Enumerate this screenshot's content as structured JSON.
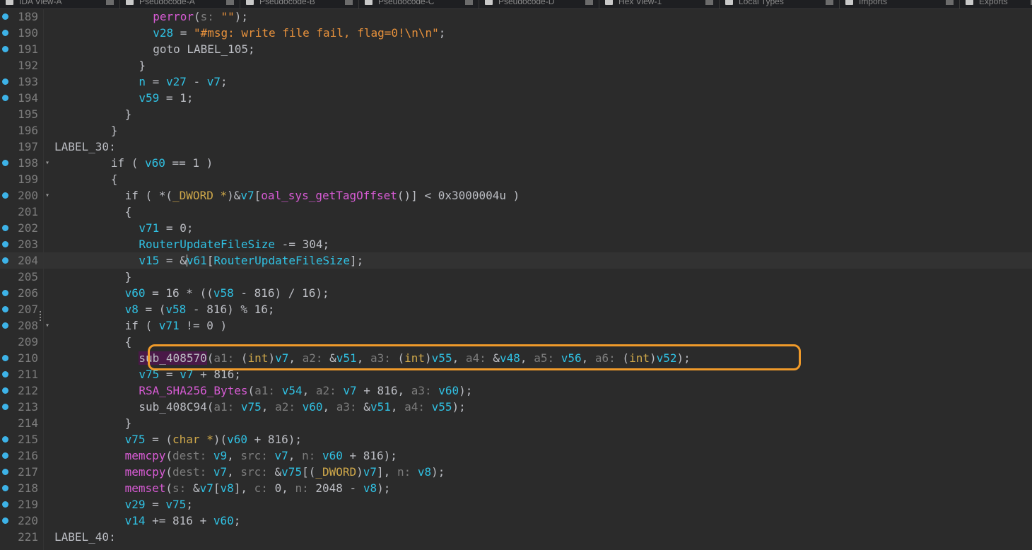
{
  "tabs": [
    {
      "label": "IDA View-A"
    },
    {
      "label": "Pseudocode-A"
    },
    {
      "label": "Pseudocode-B"
    },
    {
      "label": "Pseudocode-C"
    },
    {
      "label": "Pseudocode-D"
    },
    {
      "label": "Hex View-1"
    },
    {
      "label": "Local Types"
    },
    {
      "label": "Imports"
    },
    {
      "label": "Exports"
    }
  ],
  "lines": [
    {
      "no": "189",
      "bp": true,
      "fold": false,
      "current": false,
      "indent": 14,
      "tokens": [
        {
          "t": "f",
          "v": "perror"
        },
        {
          "t": "n",
          "v": "("
        },
        {
          "t": "h",
          "v": "s: "
        },
        {
          "t": "s",
          "v": "\"\""
        },
        {
          "t": "n",
          "v": ");"
        }
      ]
    },
    {
      "no": "190",
      "bp": true,
      "fold": false,
      "current": false,
      "indent": 14,
      "tokens": [
        {
          "t": "v",
          "v": "v28"
        },
        {
          "t": "n",
          "v": " = "
        },
        {
          "t": "s",
          "v": "\"#msg: write file fail, flag=0!\\n\\n\""
        },
        {
          "t": "n",
          "v": ";"
        }
      ]
    },
    {
      "no": "191",
      "bp": true,
      "fold": false,
      "current": false,
      "indent": 14,
      "tokens": [
        {
          "t": "n",
          "v": "goto LABEL_105;"
        }
      ]
    },
    {
      "no": "192",
      "bp": false,
      "fold": false,
      "current": false,
      "indent": 12,
      "tokens": [
        {
          "t": "n",
          "v": "}"
        }
      ]
    },
    {
      "no": "193",
      "bp": true,
      "fold": false,
      "current": false,
      "indent": 12,
      "tokens": [
        {
          "t": "v",
          "v": "n"
        },
        {
          "t": "n",
          "v": " = "
        },
        {
          "t": "v",
          "v": "v27"
        },
        {
          "t": "n",
          "v": " - "
        },
        {
          "t": "v",
          "v": "v7"
        },
        {
          "t": "n",
          "v": ";"
        }
      ]
    },
    {
      "no": "194",
      "bp": true,
      "fold": false,
      "current": false,
      "indent": 12,
      "tokens": [
        {
          "t": "v",
          "v": "v59"
        },
        {
          "t": "n",
          "v": " = 1;"
        }
      ]
    },
    {
      "no": "195",
      "bp": false,
      "fold": false,
      "current": false,
      "indent": 10,
      "tokens": [
        {
          "t": "n",
          "v": "}"
        }
      ]
    },
    {
      "no": "196",
      "bp": false,
      "fold": false,
      "current": false,
      "indent": 8,
      "tokens": [
        {
          "t": "n",
          "v": "}"
        }
      ]
    },
    {
      "no": "197",
      "bp": false,
      "fold": false,
      "current": false,
      "indent": 0,
      "tokens": [
        {
          "t": "n",
          "v": "LABEL_30:"
        }
      ]
    },
    {
      "no": "198",
      "bp": true,
      "fold": true,
      "current": false,
      "indent": 8,
      "tokens": [
        {
          "t": "n",
          "v": "if ( "
        },
        {
          "t": "v",
          "v": "v60"
        },
        {
          "t": "n",
          "v": " == 1 )"
        }
      ]
    },
    {
      "no": "199",
      "bp": false,
      "fold": false,
      "current": false,
      "indent": 8,
      "tokens": [
        {
          "t": "n",
          "v": "{"
        }
      ]
    },
    {
      "no": "200",
      "bp": true,
      "fold": true,
      "current": false,
      "indent": 10,
      "tokens": [
        {
          "t": "n",
          "v": "if ( *("
        },
        {
          "t": "k",
          "v": "_DWORD *"
        },
        {
          "t": "n",
          "v": ")&"
        },
        {
          "t": "v",
          "v": "v7"
        },
        {
          "t": "n",
          "v": "["
        },
        {
          "t": "f",
          "v": "oal_sys_getTagOffset"
        },
        {
          "t": "n",
          "v": "()] < 0x3000004u )"
        }
      ]
    },
    {
      "no": "201",
      "bp": false,
      "fold": false,
      "current": false,
      "indent": 10,
      "tokens": [
        {
          "t": "n",
          "v": "{"
        }
      ]
    },
    {
      "no": "202",
      "bp": true,
      "fold": false,
      "current": false,
      "indent": 12,
      "tokens": [
        {
          "t": "v",
          "v": "v71"
        },
        {
          "t": "n",
          "v": " = 0;"
        }
      ]
    },
    {
      "no": "203",
      "bp": true,
      "fold": false,
      "current": false,
      "indent": 12,
      "tokens": [
        {
          "t": "v",
          "v": "RouterUpdateFileSize"
        },
        {
          "t": "n",
          "v": " -= 304;"
        }
      ]
    },
    {
      "no": "204",
      "bp": true,
      "fold": false,
      "current": true,
      "indent": 12,
      "tokens": [
        {
          "t": "v",
          "v": "v15"
        },
        {
          "t": "n",
          "v": " = &"
        },
        {
          "t": "caret",
          "v": ""
        },
        {
          "t": "v",
          "v": "v61"
        },
        {
          "t": "n",
          "v": "["
        },
        {
          "t": "v",
          "v": "RouterUpdateFileSize"
        },
        {
          "t": "n",
          "v": "];"
        }
      ]
    },
    {
      "no": "205",
      "bp": false,
      "fold": false,
      "current": false,
      "indent": 10,
      "tokens": [
        {
          "t": "n",
          "v": "}"
        }
      ]
    },
    {
      "no": "206",
      "bp": true,
      "fold": false,
      "current": false,
      "indent": 10,
      "tokens": [
        {
          "t": "v",
          "v": "v60"
        },
        {
          "t": "n",
          "v": " = 16 * (("
        },
        {
          "t": "v",
          "v": "v58"
        },
        {
          "t": "n",
          "v": " - 816) / 16);"
        }
      ]
    },
    {
      "no": "207",
      "bp": true,
      "fold": false,
      "current": false,
      "indent": 10,
      "tokens": [
        {
          "t": "v",
          "v": "v8"
        },
        {
          "t": "n",
          "v": " = ("
        },
        {
          "t": "v",
          "v": "v58"
        },
        {
          "t": "n",
          "v": " - 816) % 16;"
        }
      ]
    },
    {
      "no": "208",
      "bp": true,
      "fold": true,
      "current": false,
      "indent": 10,
      "tokens": [
        {
          "t": "n",
          "v": "if ( "
        },
        {
          "t": "v",
          "v": "v71"
        },
        {
          "t": "n",
          "v": " != 0 )"
        }
      ]
    },
    {
      "no": "209",
      "bp": false,
      "fold": false,
      "current": false,
      "indent": 10,
      "tokens": [
        {
          "t": "n",
          "v": "{"
        }
      ]
    },
    {
      "no": "210",
      "bp": true,
      "fold": false,
      "current": false,
      "indent": 12,
      "tokens": [
        {
          "t": "sel",
          "v": "sub_408570"
        },
        {
          "t": "n",
          "v": "("
        },
        {
          "t": "h",
          "v": "a1: "
        },
        {
          "t": "n",
          "v": "("
        },
        {
          "t": "k",
          "v": "int"
        },
        {
          "t": "n",
          "v": ")"
        },
        {
          "t": "v",
          "v": "v7"
        },
        {
          "t": "n",
          "v": ", "
        },
        {
          "t": "h",
          "v": "a2: "
        },
        {
          "t": "n",
          "v": "&"
        },
        {
          "t": "v",
          "v": "v51"
        },
        {
          "t": "n",
          "v": ", "
        },
        {
          "t": "h",
          "v": "a3: "
        },
        {
          "t": "n",
          "v": "("
        },
        {
          "t": "k",
          "v": "int"
        },
        {
          "t": "n",
          "v": ")"
        },
        {
          "t": "v",
          "v": "v55"
        },
        {
          "t": "n",
          "v": ", "
        },
        {
          "t": "h",
          "v": "a4: "
        },
        {
          "t": "n",
          "v": "&"
        },
        {
          "t": "v",
          "v": "v48"
        },
        {
          "t": "n",
          "v": ", "
        },
        {
          "t": "h",
          "v": "a5: "
        },
        {
          "t": "v",
          "v": "v56"
        },
        {
          "t": "n",
          "v": ", "
        },
        {
          "t": "h",
          "v": "a6: "
        },
        {
          "t": "n",
          "v": "("
        },
        {
          "t": "k",
          "v": "int"
        },
        {
          "t": "n",
          "v": ")"
        },
        {
          "t": "v",
          "v": "v52"
        },
        {
          "t": "n",
          "v": ");"
        }
      ]
    },
    {
      "no": "211",
      "bp": true,
      "fold": false,
      "current": false,
      "indent": 12,
      "tokens": [
        {
          "t": "v",
          "v": "v75"
        },
        {
          "t": "n",
          "v": " = "
        },
        {
          "t": "v",
          "v": "v7"
        },
        {
          "t": "n",
          "v": " + 816;"
        }
      ]
    },
    {
      "no": "212",
      "bp": true,
      "fold": false,
      "current": false,
      "indent": 12,
      "tokens": [
        {
          "t": "f",
          "v": "RSA_SHA256_Bytes"
        },
        {
          "t": "n",
          "v": "("
        },
        {
          "t": "h",
          "v": "a1: "
        },
        {
          "t": "v",
          "v": "v54"
        },
        {
          "t": "n",
          "v": ", "
        },
        {
          "t": "h",
          "v": "a2: "
        },
        {
          "t": "v",
          "v": "v7"
        },
        {
          "t": "n",
          "v": " + 816, "
        },
        {
          "t": "h",
          "v": "a3: "
        },
        {
          "t": "v",
          "v": "v60"
        },
        {
          "t": "n",
          "v": ");"
        }
      ]
    },
    {
      "no": "213",
      "bp": true,
      "fold": false,
      "current": false,
      "indent": 12,
      "tokens": [
        {
          "t": "n",
          "v": "sub_408C94("
        },
        {
          "t": "h",
          "v": "a1: "
        },
        {
          "t": "v",
          "v": "v75"
        },
        {
          "t": "n",
          "v": ", "
        },
        {
          "t": "h",
          "v": "a2: "
        },
        {
          "t": "v",
          "v": "v60"
        },
        {
          "t": "n",
          "v": ", "
        },
        {
          "t": "h",
          "v": "a3: "
        },
        {
          "t": "n",
          "v": "&"
        },
        {
          "t": "v",
          "v": "v51"
        },
        {
          "t": "n",
          "v": ", "
        },
        {
          "t": "h",
          "v": "a4: "
        },
        {
          "t": "v",
          "v": "v55"
        },
        {
          "t": "n",
          "v": ");"
        }
      ]
    },
    {
      "no": "214",
      "bp": false,
      "fold": false,
      "current": false,
      "indent": 10,
      "tokens": [
        {
          "t": "n",
          "v": "}"
        }
      ]
    },
    {
      "no": "215",
      "bp": true,
      "fold": false,
      "current": false,
      "indent": 10,
      "tokens": [
        {
          "t": "v",
          "v": "v75"
        },
        {
          "t": "n",
          "v": " = ("
        },
        {
          "t": "k",
          "v": "char *"
        },
        {
          "t": "n",
          "v": ")("
        },
        {
          "t": "v",
          "v": "v60"
        },
        {
          "t": "n",
          "v": " + 816);"
        }
      ]
    },
    {
      "no": "216",
      "bp": true,
      "fold": false,
      "current": false,
      "indent": 10,
      "tokens": [
        {
          "t": "f",
          "v": "memcpy"
        },
        {
          "t": "n",
          "v": "("
        },
        {
          "t": "h",
          "v": "dest: "
        },
        {
          "t": "v",
          "v": "v9"
        },
        {
          "t": "n",
          "v": ", "
        },
        {
          "t": "h",
          "v": "src: "
        },
        {
          "t": "v",
          "v": "v7"
        },
        {
          "t": "n",
          "v": ", "
        },
        {
          "t": "h",
          "v": "n: "
        },
        {
          "t": "v",
          "v": "v60"
        },
        {
          "t": "n",
          "v": " + 816);"
        }
      ]
    },
    {
      "no": "217",
      "bp": true,
      "fold": false,
      "current": false,
      "indent": 10,
      "tokens": [
        {
          "t": "f",
          "v": "memcpy"
        },
        {
          "t": "n",
          "v": "("
        },
        {
          "t": "h",
          "v": "dest: "
        },
        {
          "t": "v",
          "v": "v7"
        },
        {
          "t": "n",
          "v": ", "
        },
        {
          "t": "h",
          "v": "src: "
        },
        {
          "t": "n",
          "v": "&"
        },
        {
          "t": "v",
          "v": "v75"
        },
        {
          "t": "n",
          "v": "[("
        },
        {
          "t": "k",
          "v": "_DWORD"
        },
        {
          "t": "n",
          "v": ")"
        },
        {
          "t": "v",
          "v": "v7"
        },
        {
          "t": "n",
          "v": "], "
        },
        {
          "t": "h",
          "v": "n: "
        },
        {
          "t": "v",
          "v": "v8"
        },
        {
          "t": "n",
          "v": ");"
        }
      ]
    },
    {
      "no": "218",
      "bp": true,
      "fold": false,
      "current": false,
      "indent": 10,
      "tokens": [
        {
          "t": "f",
          "v": "memset"
        },
        {
          "t": "n",
          "v": "("
        },
        {
          "t": "h",
          "v": "s: "
        },
        {
          "t": "n",
          "v": "&"
        },
        {
          "t": "v",
          "v": "v7"
        },
        {
          "t": "n",
          "v": "["
        },
        {
          "t": "v",
          "v": "v8"
        },
        {
          "t": "n",
          "v": "], "
        },
        {
          "t": "h",
          "v": "c: "
        },
        {
          "t": "n",
          "v": "0, "
        },
        {
          "t": "h",
          "v": "n: "
        },
        {
          "t": "n",
          "v": "2048 - "
        },
        {
          "t": "v",
          "v": "v8"
        },
        {
          "t": "n",
          "v": ");"
        }
      ]
    },
    {
      "no": "219",
      "bp": true,
      "fold": false,
      "current": false,
      "indent": 10,
      "tokens": [
        {
          "t": "v",
          "v": "v29"
        },
        {
          "t": "n",
          "v": " = "
        },
        {
          "t": "v",
          "v": "v75"
        },
        {
          "t": "n",
          "v": ";"
        }
      ]
    },
    {
      "no": "220",
      "bp": true,
      "fold": false,
      "current": false,
      "indent": 10,
      "tokens": [
        {
          "t": "v",
          "v": "v14"
        },
        {
          "t": "n",
          "v": " += 816 + "
        },
        {
          "t": "v",
          "v": "v60"
        },
        {
          "t": "n",
          "v": ";"
        }
      ]
    },
    {
      "no": "221",
      "bp": false,
      "fold": false,
      "current": false,
      "indent": 0,
      "tokens": [
        {
          "t": "n",
          "v": "LABEL_40:"
        }
      ]
    }
  ],
  "colors": {
    "background": "#2b2b2b",
    "keyword": "#cfa84a",
    "function": "#d75bd4",
    "variable": "#30c1e3",
    "string": "#e7913c",
    "param_hint": "#7c7c7c",
    "breakpoint": "#3db3e8",
    "highlight_box": "#ef9a2a"
  },
  "icons": {
    "breakpoint": "breakpoint-dot-icon",
    "fold": "fold-arrow-icon",
    "tab": "document-icon",
    "tab_close": "close-icon"
  }
}
